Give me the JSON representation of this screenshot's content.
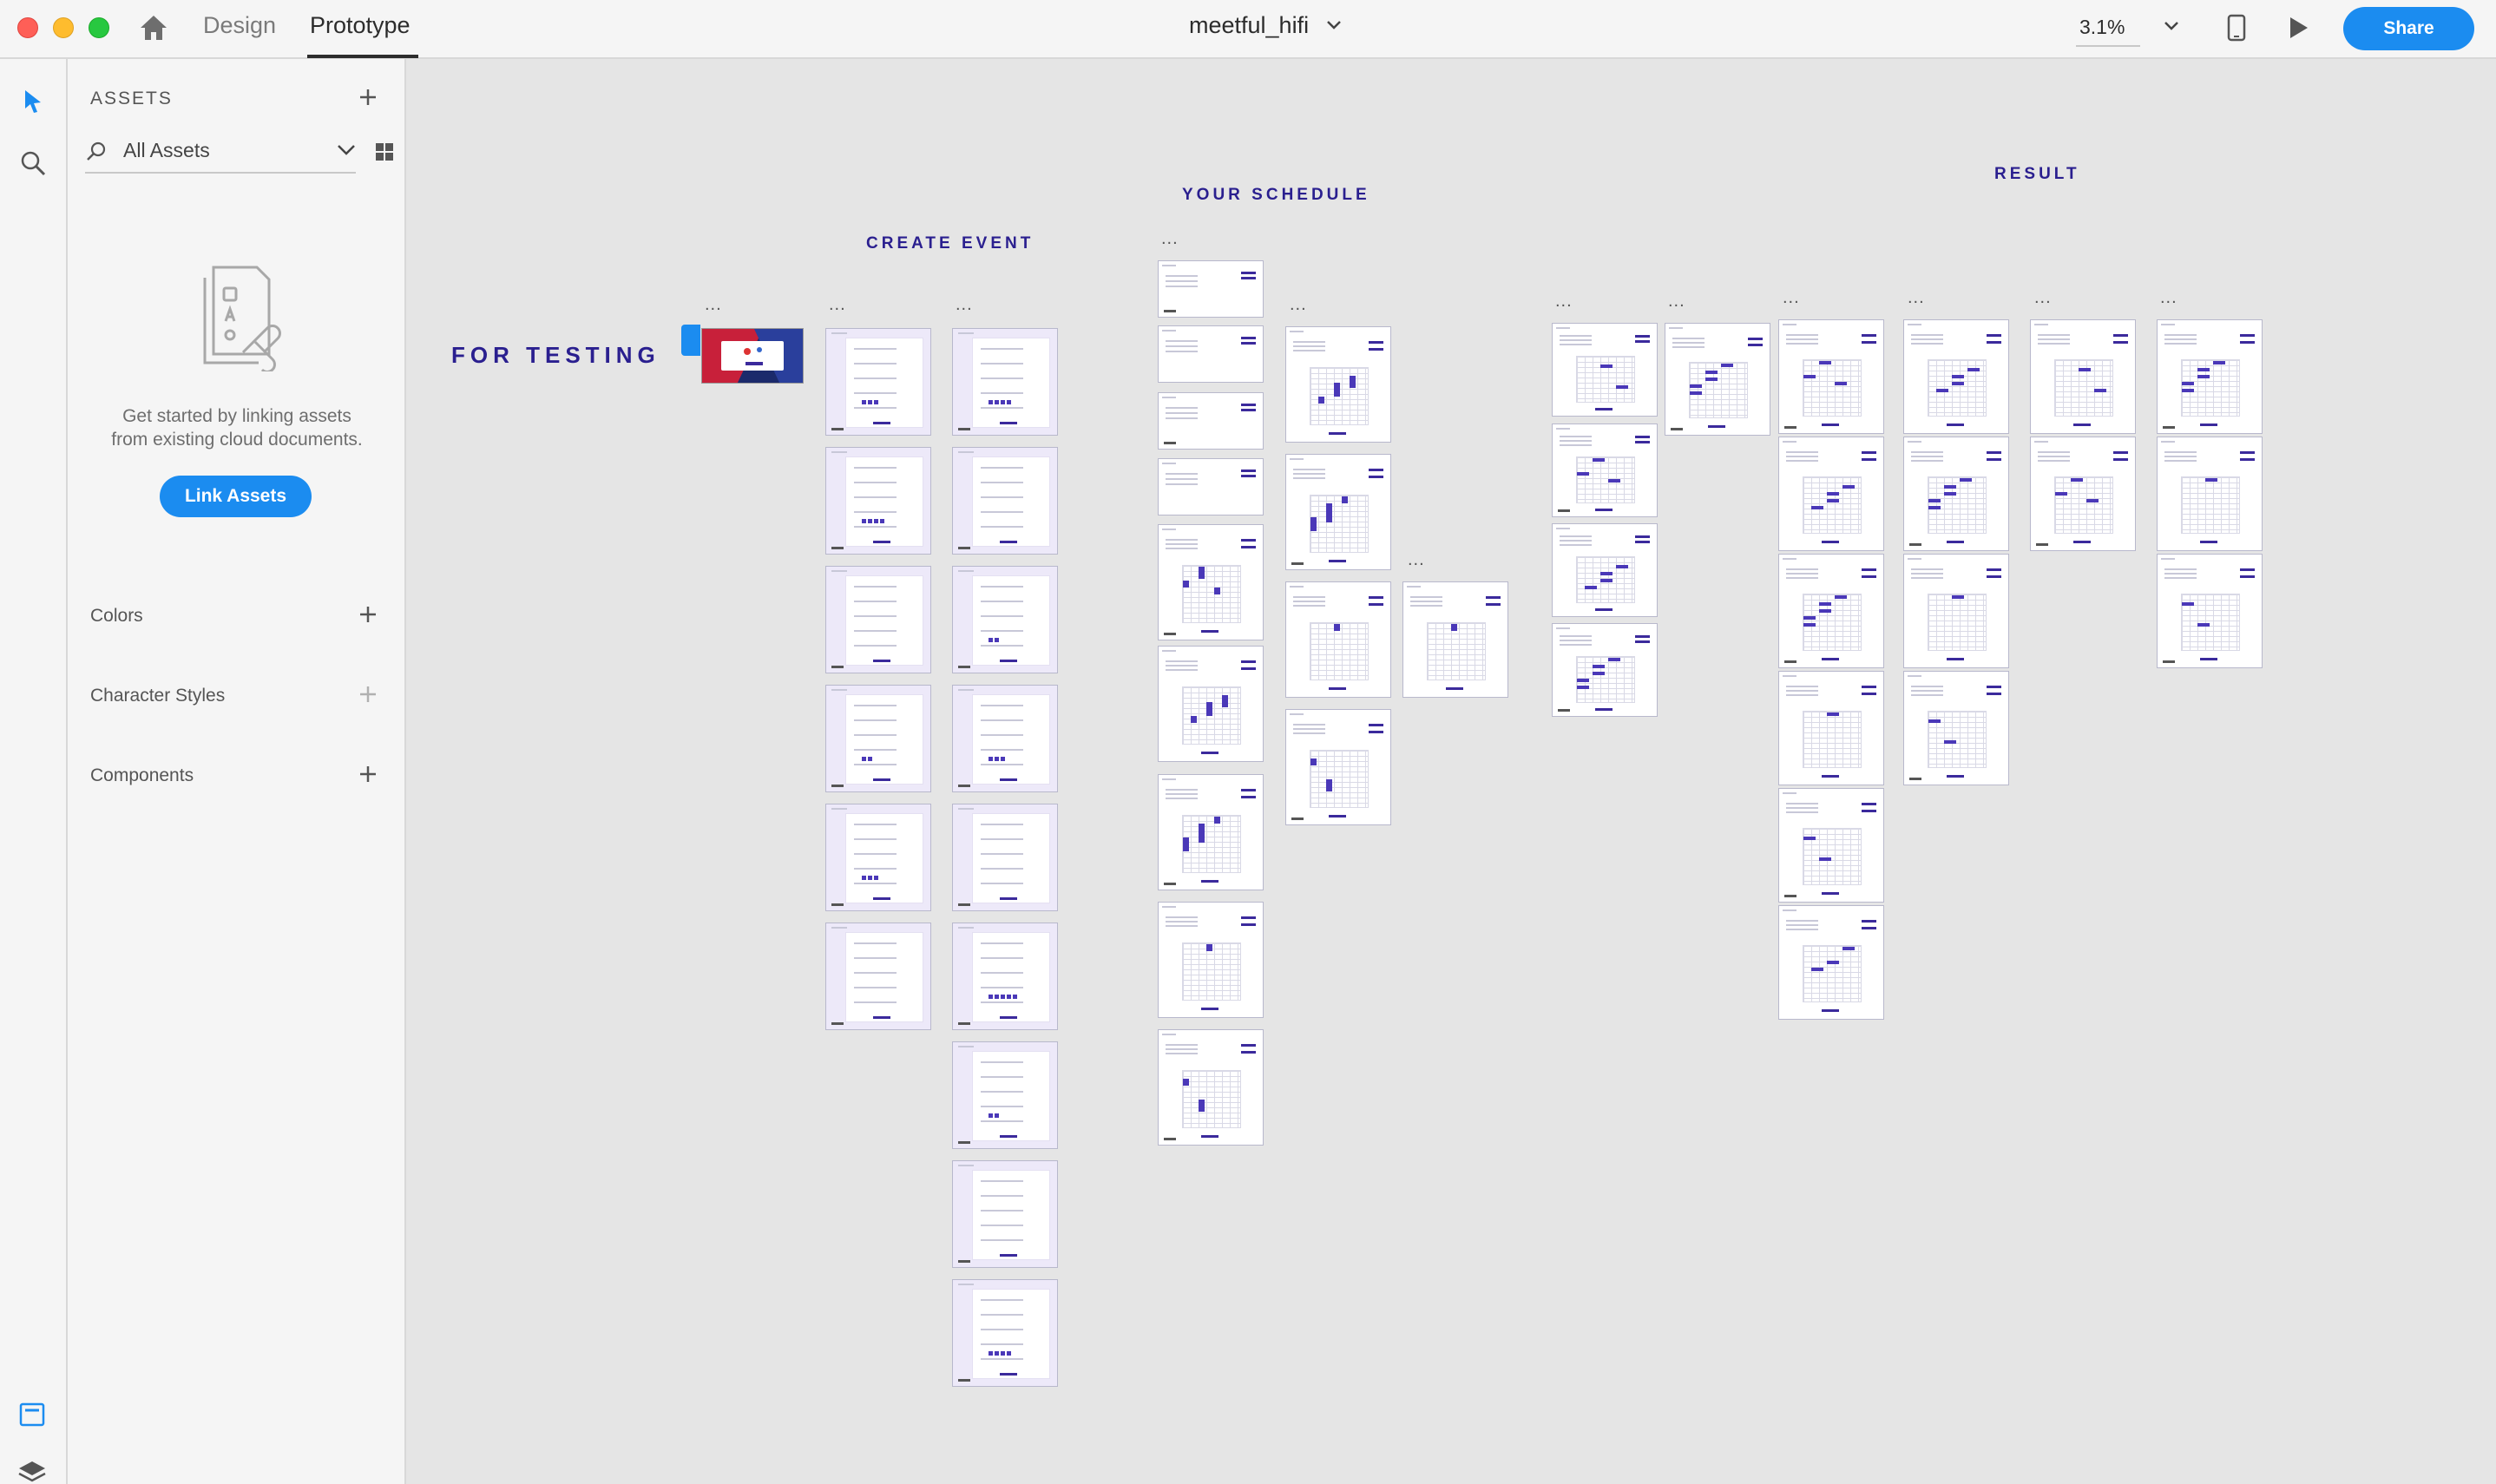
{
  "window": {
    "mode_tabs": [
      "Design",
      "Prototype"
    ],
    "active_tab": "Prototype",
    "document_title": "meetful_hifi",
    "zoom": "3.1%",
    "share_label": "Share"
  },
  "assets_panel": {
    "heading": "ASSETS",
    "filter_label": "All Assets",
    "empty_line1": "Get started by linking assets",
    "empty_line2": "from existing cloud documents.",
    "link_button": "Link Assets",
    "sections": [
      "Colors",
      "Character Styles",
      "Components"
    ]
  },
  "canvas": {
    "labels": {
      "for_testing": "FOR TESTING",
      "create_event": "CREATE EVENT",
      "your_schedule": "YOUR SCHEDULE",
      "result": "RESULT"
    },
    "ellipsis": "..."
  },
  "colors": {
    "accent_blue": "#1b8cf0",
    "label_indigo": "#2a1f8f",
    "canvas_bg": "#e5e5e5"
  }
}
